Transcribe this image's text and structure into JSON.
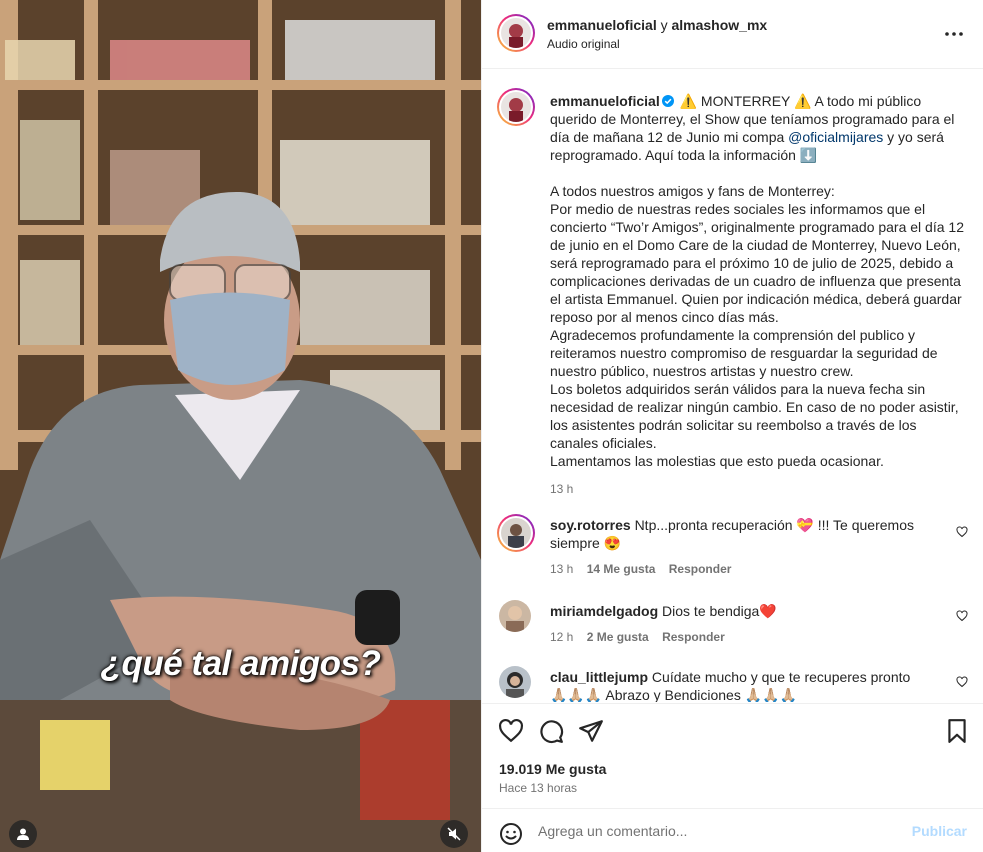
{
  "media": {
    "overlay_caption": "¿qué tal amigos?",
    "user_tag_icon": "user-icon",
    "mute_icon": "speaker-muted-icon"
  },
  "header": {
    "account": "emmanueloficial",
    "joiner": "y",
    "collab_account": "almashow_mx",
    "audio": "Audio original",
    "more_icon": "more-horizontal-icon"
  },
  "caption": {
    "username": "emmanueloficial",
    "verified_icon": "verified-badge-icon",
    "intro_before_mention": "⚠️ MONTERREY ⚠️  A todo mi público querido de Monterrey, el Show que teníamos programado para el día de mañana 12 de Junio mi compa ",
    "mention": "@oficialmijares",
    "intro_after_mention": " y yo será reprogramado. Aquí toda la información ⬇️",
    "paragraphs": [
      "A todos nuestros amigos y fans de Monterrey:",
      "Por medio de nuestras redes sociales les informamos que el concierto “Two’r Amigos”, originalmente programado para el día 12 de junio en el Domo Care de la ciudad de Monterrey, Nuevo León, será reprogramado para el próximo 10 de julio de 2025, debido a complicaciones derivadas de un cuadro de influenza que presenta el artista Emmanuel. Quien por indicación médica, deberá guardar reposo por al menos cinco días más.",
      "Agradecemos profundamente la comprensión del publico y reiteramos nuestro compromiso de resguardar la seguridad de nuestro público, nuestros artistas y nuestro crew.",
      "Los boletos adquiridos serán válidos para la nueva fecha sin necesidad de realizar ningún cambio. En caso de no poder asistir, los asistentes podrán solicitar su reembolso a través de los canales oficiales.",
      "Lamentamos las molestias que esto pueda ocasionar."
    ],
    "age": "13 h"
  },
  "comments": [
    {
      "username": "soy.rotorres",
      "text": "Ntp...pronta recuperación 💝 !!! Te queremos siempre 😍",
      "age": "13 h",
      "likes": "14 Me gusta",
      "reply": "Responder"
    },
    {
      "username": "miriamdelgadog",
      "text": "Dios te bendiga❤️",
      "age": "12 h",
      "likes": "2 Me gusta",
      "reply": "Responder"
    },
    {
      "username": "clau_littlejump",
      "text": "Cuídate mucho y que te recuperes pronto 🙏🏼🙏🏼🙏🏼 Abrazo y Bendiciones 🙏🏼🙏🏼🙏🏼",
      "age": "",
      "likes": "",
      "reply": ""
    }
  ],
  "actions": {
    "like_icon": "heart-icon",
    "comment_icon": "comment-icon",
    "share_icon": "paper-plane-icon",
    "save_icon": "bookmark-icon",
    "likes_count": "19.019 Me gusta",
    "posted": "Hace 13 horas"
  },
  "add_comment": {
    "emoji_icon": "emoji-icon",
    "placeholder": "Agrega un comentario...",
    "publish_label": "Publicar"
  },
  "colors": {
    "mention": "#00376b",
    "secondary_text": "#737373",
    "publish_disabled": "#b3dbff",
    "heart_red": "#ff3040"
  }
}
